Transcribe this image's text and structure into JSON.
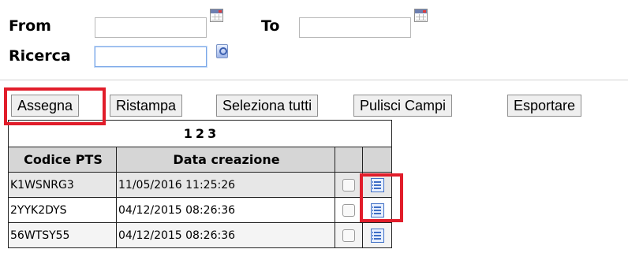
{
  "filters": {
    "from_label": "From",
    "from_value": "",
    "to_label": "To",
    "to_value": "",
    "search_label": "Ricerca",
    "search_value": ""
  },
  "toolbar": {
    "assign_label": "Assegna",
    "reprint_label": "Ristampa",
    "select_all_label": "Seleziona tutti",
    "clear_fields_label": "Pulisci Campi",
    "export_label": "Esportare"
  },
  "pager": {
    "pages": [
      "1",
      "2",
      "3"
    ]
  },
  "table": {
    "columns": [
      "Codice PTS",
      "Data creazione",
      "",
      ""
    ],
    "rows": [
      {
        "code": "K1WSNRG3",
        "created": "11/05/2016 11:25:26"
      },
      {
        "code": "2YYK2DYS",
        "created": "04/12/2015 08:26:36"
      },
      {
        "code": "56WTSY55",
        "created": "04/12/2015 08:26:36"
      }
    ]
  },
  "colors": {
    "highlight": "#e11d2a",
    "header_bg": "#d6d6d6"
  },
  "icons": [
    "calendar-icon",
    "search-icon",
    "detail-icon"
  ]
}
